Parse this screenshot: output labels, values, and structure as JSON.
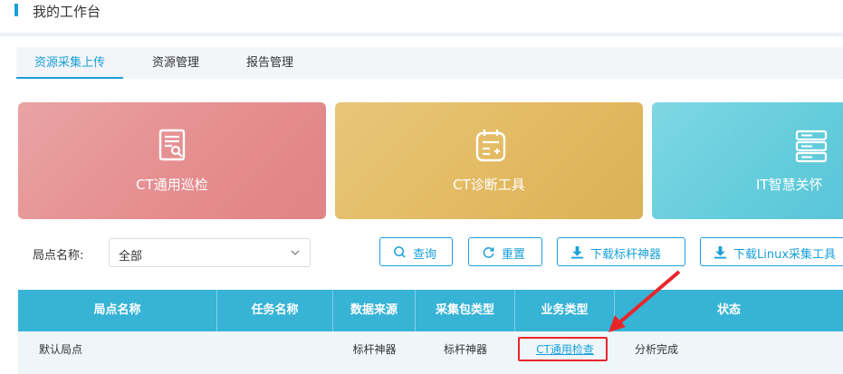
{
  "header": {
    "title": "我的工作台"
  },
  "tabs": [
    {
      "label": "资源采集上传",
      "active": true
    },
    {
      "label": "资源管理",
      "active": false
    },
    {
      "label": "报告管理",
      "active": false
    }
  ],
  "cards": [
    {
      "label": "CT通用巡检",
      "icon": "document-search-icon",
      "color": "#e89798"
    },
    {
      "label": "CT诊断工具",
      "icon": "clipboard-plus-icon",
      "color": "#e3be69"
    },
    {
      "label": "IT智慧关怀",
      "icon": "server-rack-icon",
      "color": "#6dcfde"
    }
  ],
  "filter": {
    "label": "局点名称:",
    "select_value": "全部"
  },
  "buttons": {
    "query": "查询",
    "reset": "重置",
    "download_benchmark": "下载标杆神器",
    "download_linux": "下载Linux采集工具"
  },
  "table": {
    "headers": [
      "局点名称",
      "任务名称",
      "数据来源",
      "采集包类型",
      "业务类型",
      "状态"
    ],
    "rows": [
      {
        "site": "默认局点",
        "task": "",
        "source": "标杆神器",
        "package_type": "标杆神器",
        "business_type": "CT通用检查",
        "status": "分析完成"
      }
    ]
  },
  "colors": {
    "accent": "#1aa0d8",
    "table_header": "#37b3d6",
    "annotation": "#e8262a"
  }
}
